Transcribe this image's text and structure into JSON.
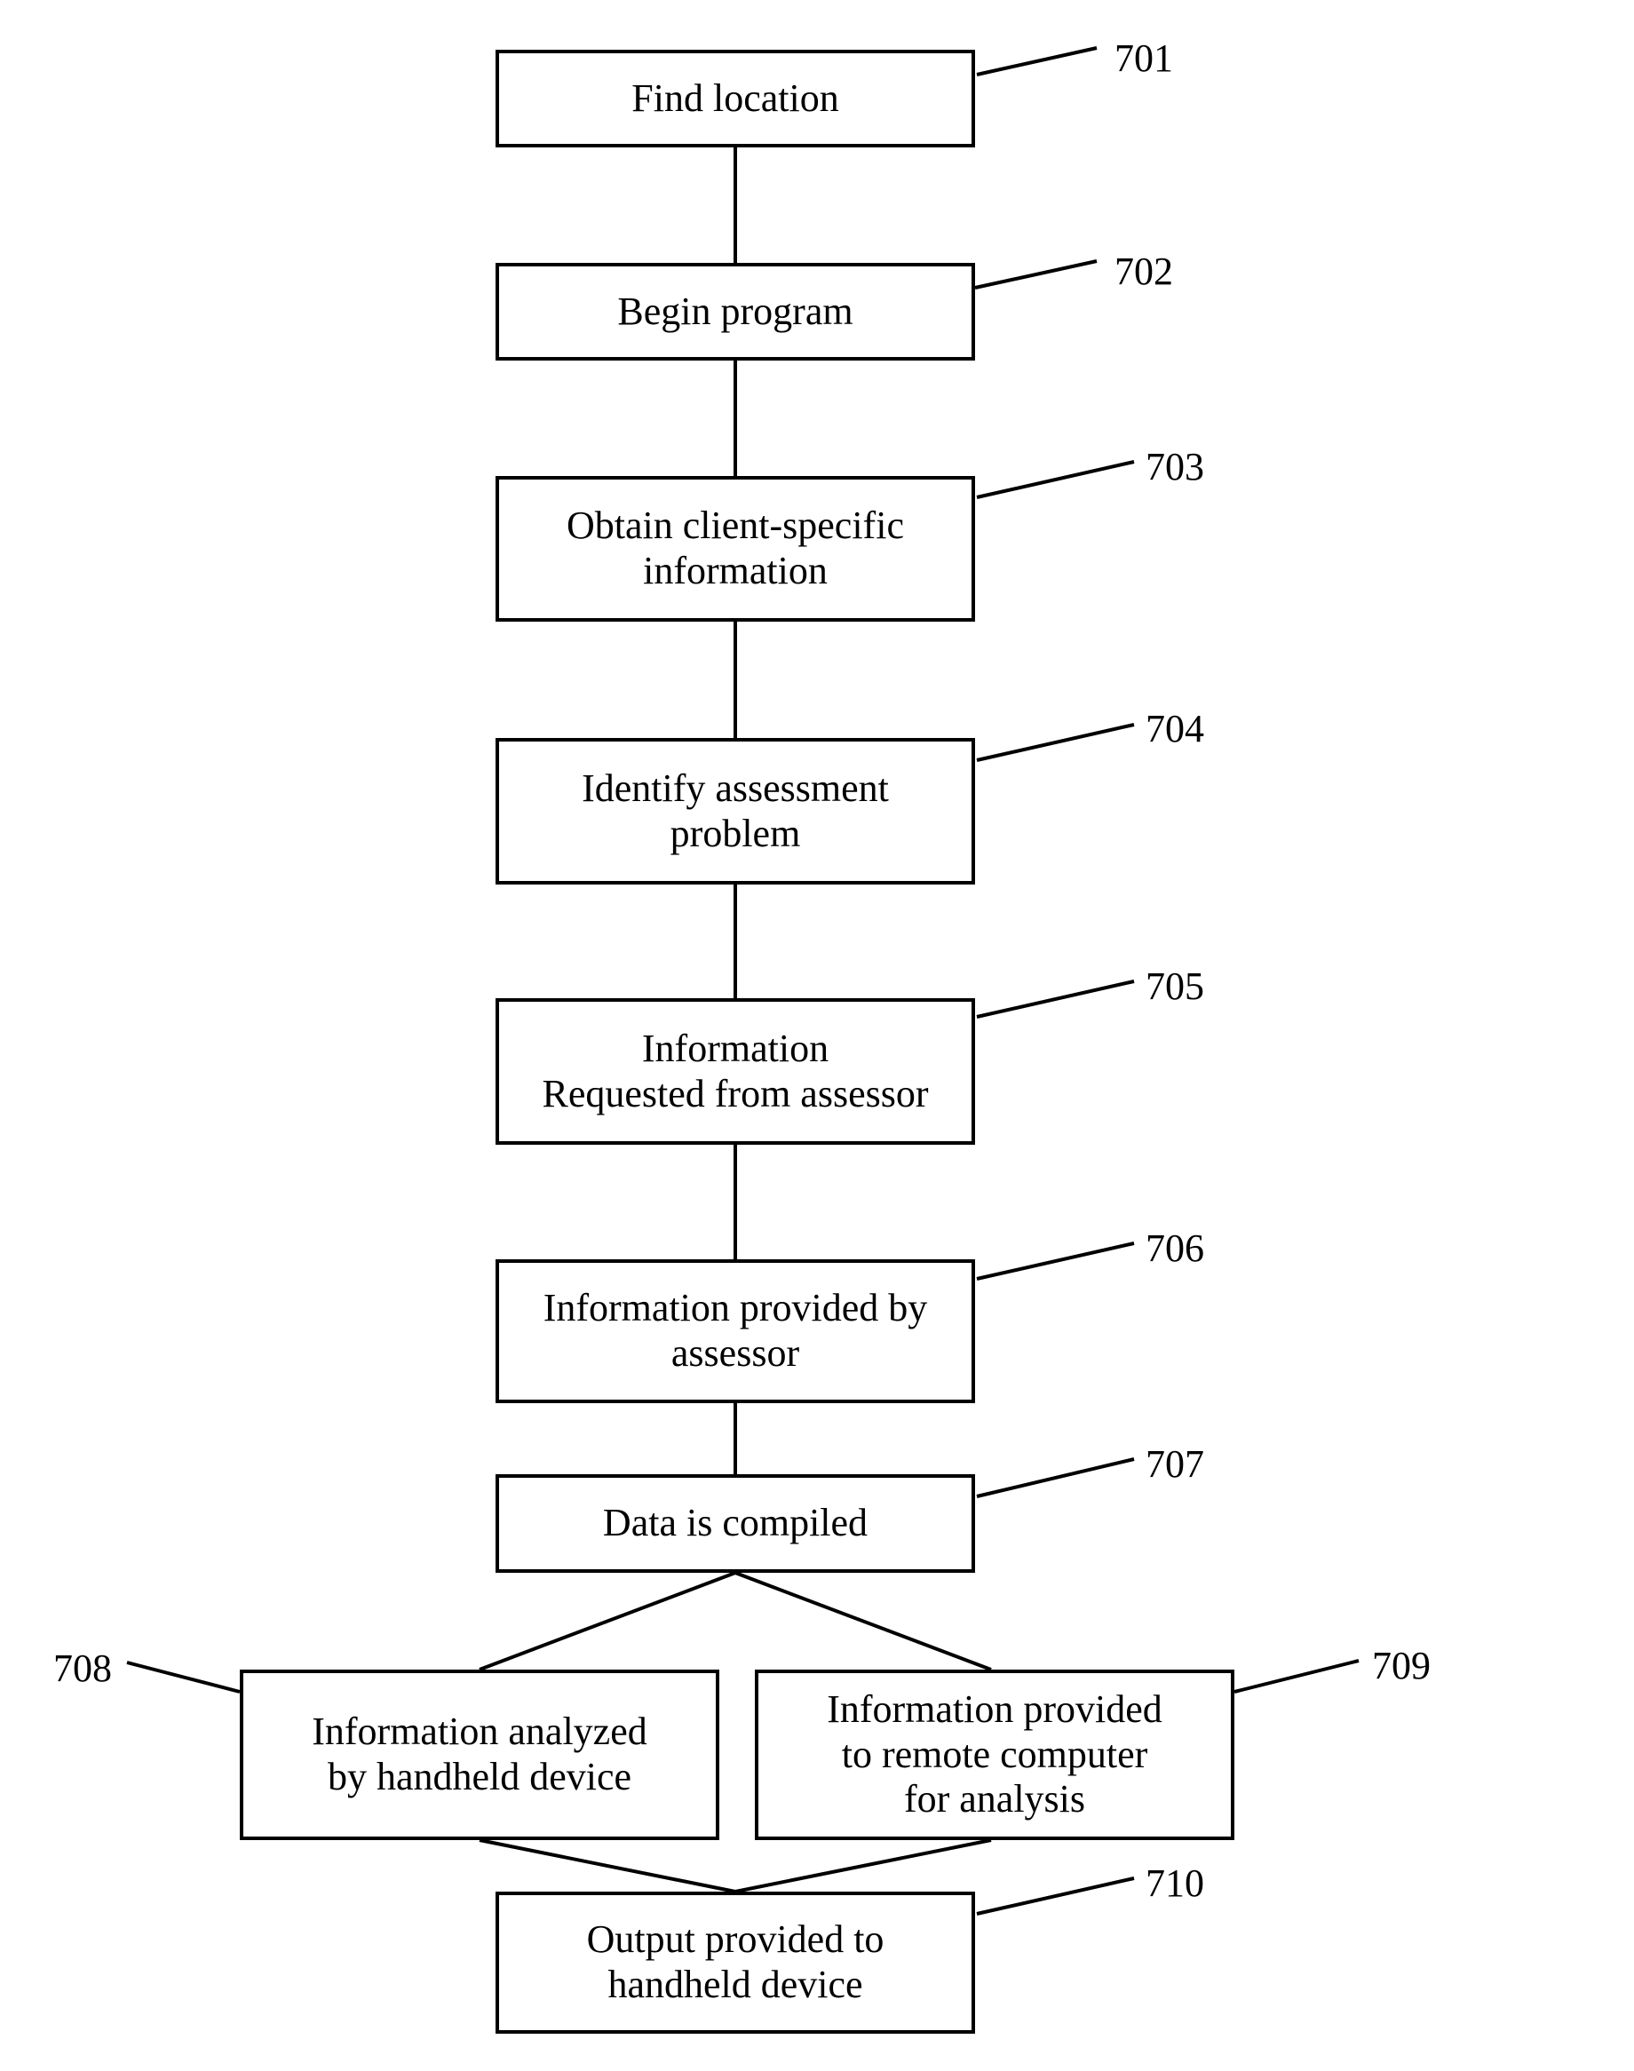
{
  "nodes": {
    "n701": {
      "label": "Find location",
      "ref": "701"
    },
    "n702": {
      "label": "Begin program",
      "ref": "702"
    },
    "n703": {
      "label": "Obtain client-specific\ninformation",
      "ref": "703"
    },
    "n704": {
      "label": "Identify assessment\nproblem",
      "ref": "704"
    },
    "n705": {
      "label": "Information\nRequested from assessor",
      "ref": "705"
    },
    "n706": {
      "label": "Information provided by\nassessor",
      "ref": "706"
    },
    "n707": {
      "label": "Data is compiled",
      "ref": "707"
    },
    "n708": {
      "label": "Information analyzed\nby handheld device",
      "ref": "708"
    },
    "n709": {
      "label": "Information provided\nto remote computer\nfor analysis",
      "ref": "709"
    },
    "n710": {
      "label": "Output provided to\nhandheld device",
      "ref": "710"
    }
  }
}
